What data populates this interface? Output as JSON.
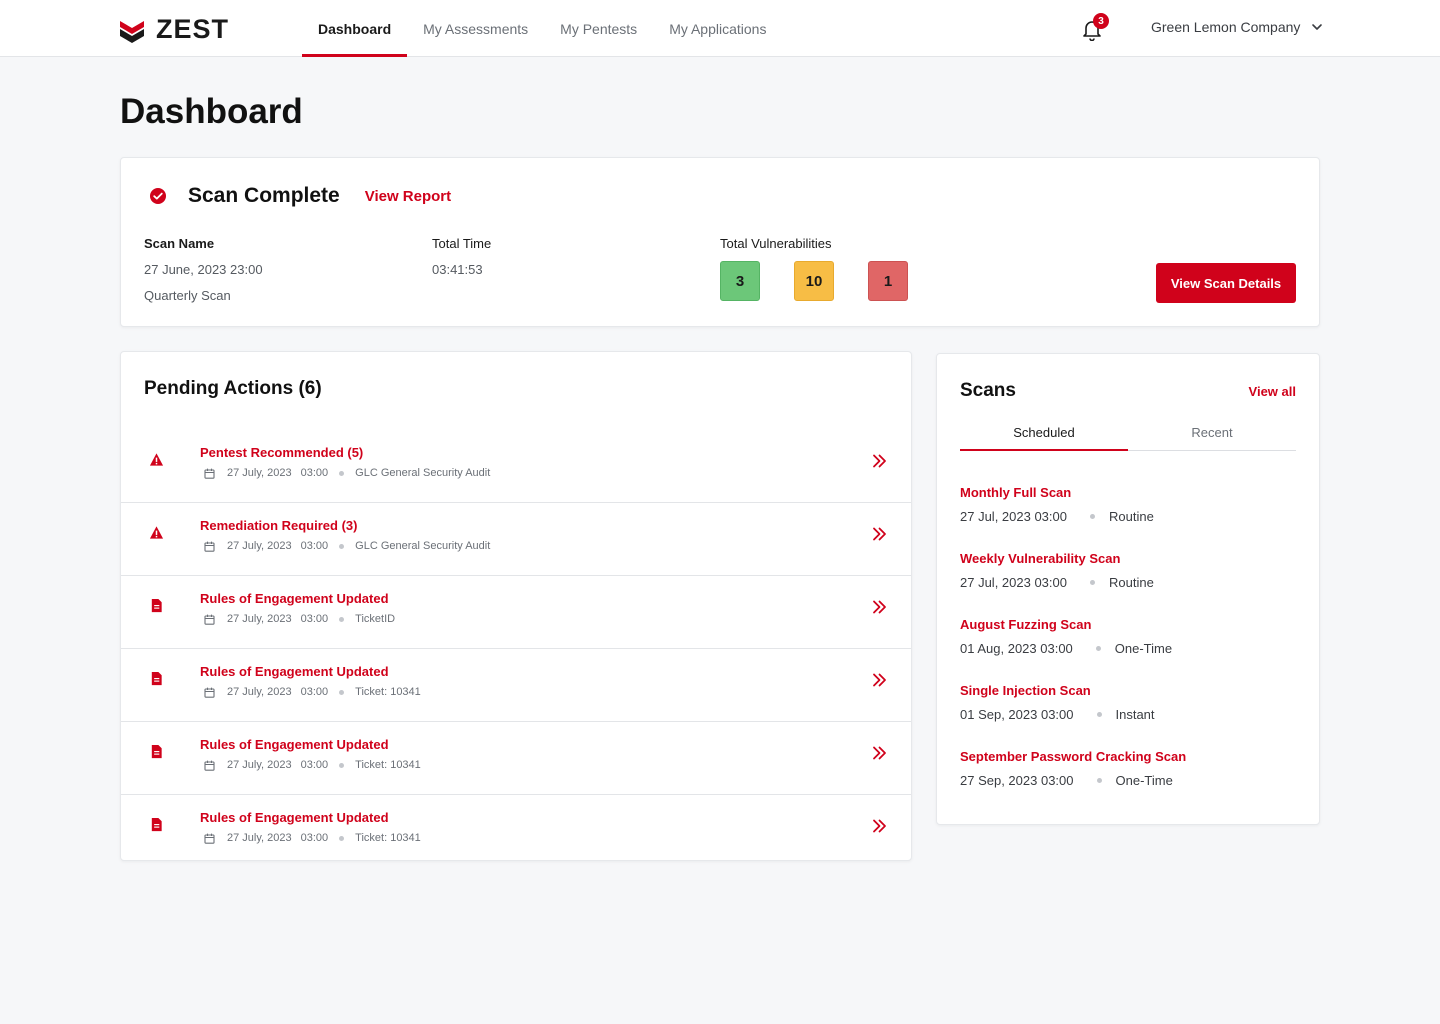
{
  "header": {
    "logo_text": "ZEST",
    "nav": [
      {
        "label": "Dashboard",
        "active": true
      },
      {
        "label": "My Assessments"
      },
      {
        "label": "My Pentests"
      },
      {
        "label": "My Applications"
      }
    ],
    "notifications_count": "3",
    "company": "Green Lemon Company"
  },
  "page_title": "Dashboard",
  "scan": {
    "status": "Scan Complete",
    "view_report": "View Report",
    "name_label": "Scan Name",
    "name_date": "27 June, 2023 23:00",
    "name_value": "Quarterly Scan",
    "time_label": "Total Time",
    "time_value": "03:41:53",
    "vuln_label": "Total Vulnerabilities",
    "vuln_low": "3",
    "vuln_medium": "10",
    "vuln_high": "1",
    "details_button": "View Scan Details"
  },
  "pending": {
    "title": "Pending Actions (6)",
    "items": [
      {
        "icon": "warning-icon",
        "title": "Pentest Recommended (5)",
        "date": "27 July, 2023",
        "time": "03:00",
        "ref": "GLC General Security Audit"
      },
      {
        "icon": "warning-icon",
        "title": "Remediation Required (3)",
        "date": "27 July, 2023",
        "time": "03:00",
        "ref": "GLC General Security Audit"
      },
      {
        "icon": "document-icon",
        "title": "Rules of Engagement Updated",
        "date": "27 July, 2023",
        "time": "03:00",
        "ref": "TicketID"
      },
      {
        "icon": "document-icon",
        "title": "Rules of Engagement Updated",
        "date": "27 July, 2023",
        "time": "03:00",
        "ref": "Ticket: 10341"
      },
      {
        "icon": "document-icon",
        "title": "Rules of Engagement Updated",
        "date": "27 July, 2023",
        "time": "03:00",
        "ref": "Ticket: 10341"
      },
      {
        "icon": "document-icon",
        "title": "Rules of Engagement Updated",
        "date": "27 July, 2023",
        "time": "03:00",
        "ref": "Ticket: 10341"
      }
    ]
  },
  "scans": {
    "title": "Scans",
    "view_all": "View all",
    "tabs": [
      {
        "label": "Scheduled",
        "active": true
      },
      {
        "label": "Recent"
      }
    ],
    "items": [
      {
        "name": "Monthly Full Scan",
        "datetime": "27 Jul, 2023 03:00",
        "type": "Routine"
      },
      {
        "name": "Weekly Vulnerability Scan",
        "datetime": "27 Jul, 2023 03:00",
        "type": "Routine"
      },
      {
        "name": "August Fuzzing Scan",
        "datetime": "01 Aug, 2023 03:00",
        "type": "One-Time"
      },
      {
        "name": "Single Injection Scan",
        "datetime": "01 Sep, 2023 03:00",
        "type": "Instant"
      },
      {
        "name": "September Password Cracking Scan",
        "datetime": "27 Sep, 2023 03:00",
        "type": "One-Time"
      }
    ]
  },
  "colors": {
    "accent": "#d0021b",
    "low": "#6cc779",
    "medium": "#f7bd45",
    "high": "#e06666"
  }
}
